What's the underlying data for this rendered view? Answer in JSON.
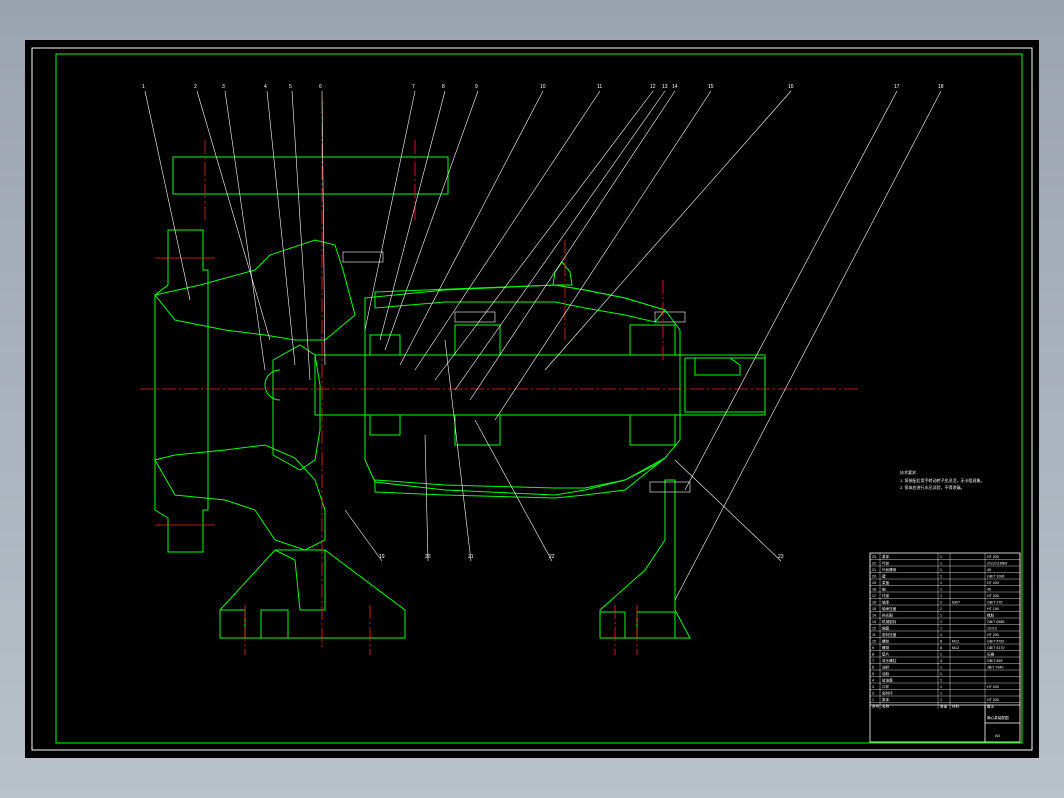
{
  "drawing": {
    "callouts": [
      {
        "text": "1"
      },
      {
        "text": "2"
      },
      {
        "text": "3"
      },
      {
        "text": "4"
      },
      {
        "text": "5"
      },
      {
        "text": "6"
      },
      {
        "text": "7"
      },
      {
        "text": "8"
      },
      {
        "text": "9"
      },
      {
        "text": "10"
      },
      {
        "text": "11"
      },
      {
        "text": "12"
      },
      {
        "text": "13"
      },
      {
        "text": "14"
      },
      {
        "text": "15"
      },
      {
        "text": "16"
      },
      {
        "text": "17"
      },
      {
        "text": "18"
      },
      {
        "text": "19"
      },
      {
        "text": "20"
      },
      {
        "text": "21"
      },
      {
        "text": "22"
      },
      {
        "text": "23"
      }
    ],
    "notes": {
      "title": "技术要求",
      "line1": "1. 泵装配后用手转动转子应灵活，无卡阻现象。",
      "line2": "2. 泵体应进行水压试验，不得渗漏。"
    },
    "title_block": {
      "rows": [
        {
          "no": "23",
          "name": "泵体",
          "qty": "1",
          "spec": "",
          "std": "HT 200"
        },
        {
          "no": "22",
          "name": "叶轮",
          "qty": "1",
          "spec": "",
          "std": "ZG1Cr18Ni9"
        },
        {
          "no": "21",
          "name": "叶轮螺母",
          "qty": "1",
          "spec": "",
          "std": "45"
        },
        {
          "no": "20",
          "name": "键",
          "qty": "1",
          "spec": "",
          "std": "GB/T 1096"
        },
        {
          "no": "19",
          "name": "泵盖",
          "qty": "1",
          "spec": "",
          "std": "HT 200"
        },
        {
          "no": "18",
          "name": "轴",
          "qty": "1",
          "spec": "",
          "std": "45"
        },
        {
          "no": "17",
          "name": "托架",
          "qty": "1",
          "spec": "",
          "std": "HT 200"
        },
        {
          "no": "16",
          "name": "轴承",
          "qty": "2",
          "spec": "6307",
          "std": "GB/T 276"
        },
        {
          "no": "15",
          "name": "轴承压盖",
          "qty": "2",
          "spec": "",
          "std": "HT 150"
        },
        {
          "no": "14",
          "name": "挡水圈",
          "qty": "1",
          "spec": "",
          "std": "橡胶"
        },
        {
          "no": "13",
          "name": "机械密封",
          "qty": "1",
          "spec": "",
          "std": "GB/T 6556"
        },
        {
          "no": "12",
          "name": "轴套",
          "qty": "1",
          "spec": "",
          "std": "1Cr13"
        },
        {
          "no": "11",
          "name": "密封压盖",
          "qty": "1",
          "spec": "",
          "std": "HT 200"
        },
        {
          "no": "10",
          "name": "螺栓",
          "qty": "8",
          "spec": "M12",
          "std": "GB/T 5782"
        },
        {
          "no": "9",
          "name": "螺母",
          "qty": "8",
          "spec": "M12",
          "std": "GB/T 6170"
        },
        {
          "no": "8",
          "name": "垫片",
          "qty": "1",
          "spec": "",
          "std": "石棉"
        },
        {
          "no": "7",
          "name": "双头螺柱",
          "qty": "4",
          "spec": "",
          "std": "GB/T 899"
        },
        {
          "no": "6",
          "name": "油杯",
          "qty": "1",
          "spec": "",
          "std": "JB/T 7940"
        },
        {
          "no": "5",
          "name": "油标",
          "qty": "1",
          "spec": "",
          "std": ""
        },
        {
          "no": "4",
          "name": "放油塞",
          "qty": "1",
          "spec": "",
          "std": ""
        },
        {
          "no": "3",
          "name": "口环",
          "qty": "1",
          "spec": "",
          "std": "HT 200"
        },
        {
          "no": "2",
          "name": "密封环",
          "qty": "1",
          "spec": "",
          "std": ""
        },
        {
          "no": "1",
          "name": "泵体",
          "qty": "1",
          "spec": "",
          "std": "HT 200"
        }
      ],
      "header": {
        "no": "序号",
        "name": "名称",
        "qty": "数量",
        "spec": "材料",
        "std": "备注"
      },
      "drawing_title": "离心泵装配图",
      "sheet_size": "A0"
    }
  }
}
